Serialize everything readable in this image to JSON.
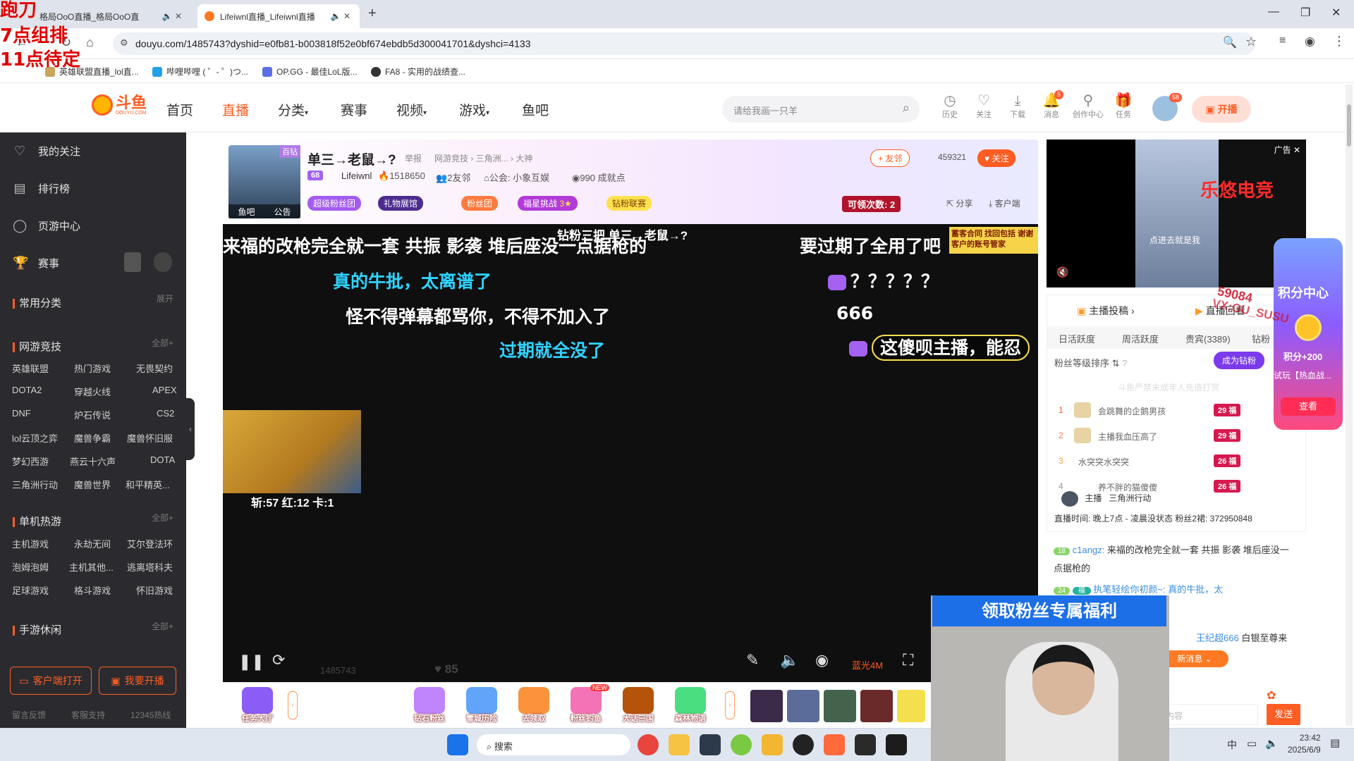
{
  "browser": {
    "tabs": [
      {
        "title": "格局OoO直播_格局OoO直",
        "active": false
      },
      {
        "title": "Lifeiwnl直播_Lifeiwnl直播",
        "active": true
      }
    ],
    "url": "douyu.com/1485743?dyshid=e0fb81-b003818f52e0bf674ebdb5d300041701&dyshci=4133",
    "bookmarks": [
      {
        "label": "英雄联盟直播_lol直..."
      },
      {
        "label": "哔哩哔哩 ( ゜- ゜)つ..."
      },
      {
        "label": "OP.GG - 最佳LoL版..."
      },
      {
        "label": "FA8 - 实用的战绩查..."
      }
    ]
  },
  "overlay_note": [
    "跑刀",
    "7点组排",
    "11点待定"
  ],
  "site": {
    "logo_text": "斗鱼",
    "logo_sub": "DOUYU.COM",
    "nav": [
      "首页",
      "直播",
      "分类",
      "赛事",
      "视频",
      "游戏",
      "鱼吧"
    ],
    "search_placeholder": "请给我画一只羊",
    "header_icons": [
      {
        "label": "历史",
        "icon": "clock-icon"
      },
      {
        "label": "关注",
        "icon": "heart-icon"
      },
      {
        "label": "下载",
        "icon": "download-icon"
      },
      {
        "label": "消息",
        "icon": "bell-icon",
        "badge": "5"
      },
      {
        "label": "创作中心",
        "icon": "bulb-icon"
      },
      {
        "label": "任务",
        "icon": "gift-icon"
      }
    ],
    "avatar_badge": "58",
    "start_live_label": "开播"
  },
  "sidebar": {
    "top_items": [
      {
        "label": "我的关注",
        "icon": "heart-icon"
      },
      {
        "label": "排行榜",
        "icon": "ranking-icon"
      },
      {
        "label": "页游中心",
        "icon": "gamepad-icon"
      },
      {
        "label": "赛事",
        "icon": "trophy-icon"
      }
    ],
    "common": {
      "title": "常用分类",
      "action": "展开"
    },
    "sections": [
      {
        "title": "网游竞技",
        "action": "全部",
        "games": [
          "英雄联盟",
          "热门游戏",
          "无畏契约",
          "DOTA2",
          "穿越火线",
          "APEX",
          "DNF",
          "炉石传说",
          "CS2",
          "lol云顶之弈",
          "魔兽争霸",
          "魔兽怀旧服",
          "梦幻西游",
          "燕云十六声",
          "DOTA",
          "三角洲行动",
          "魔兽世界",
          "和平精英..."
        ]
      },
      {
        "title": "单机热游",
        "action": "全部",
        "games": [
          "主机游戏",
          "永劫无间",
          "艾尔登法环",
          "泡姆泡姆",
          "主机其他...",
          "逃离塔科夫",
          "足球游戏",
          "格斗游戏",
          "怀旧游戏"
        ]
      },
      {
        "title": "手游休闲",
        "action": "全部",
        "games": []
      }
    ],
    "buttons": [
      "客户端打开",
      "我要开播"
    ],
    "footer": [
      "留言反馈",
      "客服支持",
      "12345热线"
    ]
  },
  "room": {
    "title": "单三→老鼠→?",
    "report": "举报",
    "category": "网游竞技 › 三角洲... › 大神",
    "badge_level": "68",
    "streamer": "Lifeiwnl",
    "hot": "1518650",
    "neighbors": "2友邻",
    "guild": "公会: 小象互娱",
    "achievements": "990 成就点",
    "thumb_tabs": [
      "鱼吧",
      "公告"
    ],
    "tags": [
      "超级粉丝团",
      "礼物展馆",
      "粉丝团",
      "福星挑战",
      "钻粉联赛"
    ],
    "challenge_stars": "3",
    "friend_label": "友邻",
    "follow_count": "459321",
    "follow_label": "关注",
    "claim_label": "可领次数: 2",
    "share_label": "分享",
    "client_label": "客户端",
    "diamond_label": "百钻"
  },
  "video": {
    "top_title": "钻粉三把 单三→老鼠→?",
    "danmaku": [
      {
        "text": "来福的改枪完全就一套 共振 影袭 堆后座没一点据枪的",
        "color": "#ffffff"
      },
      {
        "text": "要过期了全用了吧",
        "color": "#ffffff"
      },
      {
        "text": "真的牛批，太离谱了",
        "color": "#2fd3ff"
      },
      {
        "text": "？？？？？",
        "color": "#ffffff"
      },
      {
        "text": "怪不得弹幕都骂你，不得不加入了",
        "color": "#ffffff"
      },
      {
        "text": "666",
        "color": "#ffffff"
      },
      {
        "text": "过期就全没了",
        "color": "#2fd3ff"
      },
      {
        "text": "这傻呗主播，能忍",
        "color": "#ffffff"
      }
    ],
    "stats": "斩:57 红:12 卡:1",
    "quality": "蓝光4M",
    "room_id": "1485743",
    "hot_bottom": "85",
    "top_banner": "蓄客合同 找回包括 谢谢客户的账号管家"
  },
  "giftbar": {
    "task_label": "任务大厅",
    "gifts": [
      "钻石粉丝",
      "雪城历险",
      "去领取",
      "粉丝钓鱼",
      "大话三国",
      "森林物语"
    ],
    "new_tag": "NEW"
  },
  "ad": {
    "label": "广告",
    "brand": "乐悠电竞",
    "caption": "点进去就是我"
  },
  "rank": {
    "submit_label": "主播投稿",
    "review_label": "直播回看",
    "tabs": [
      "日活跃度",
      "周活跃度",
      "贵宾(3389)",
      "钻粉"
    ],
    "sort_label": "粉丝等级排序",
    "become_label": "成为钻粉",
    "notice": "斗鱼严禁未成年人充值打赏",
    "users": [
      {
        "rank": "1",
        "name": "会跳舞的企鹅男孩",
        "level": "29"
      },
      {
        "rank": "2",
        "name": "主播我血压高了",
        "level": "29"
      },
      {
        "rank": "3",
        "name": "水突突水突突",
        "level": "26"
      },
      {
        "rank": "4",
        "name": "养不胖的猫傻傻",
        "level": "26"
      }
    ],
    "fan_tag": "福"
  },
  "chat": {
    "host_tags": [
      "主播",
      "三角洲行动"
    ],
    "live_info": "直播时间: 晚上7点 - 凌晨没状态 粉丝2裙: 372950848",
    "messages": [
      {
        "level": "18",
        "user": "c1angz:",
        "text": "来福的改枪完全就一套 共振 影袭 堆后座没一点据枪的"
      },
      {
        "level": "24",
        "user": "执笔轻绘你初颜~:",
        "text": "真的牛批，太"
      }
    ],
    "system_user": "王纪超666",
    "system_text": "白银至尊来",
    "new_msg": "新消息",
    "send_label": "发送",
    "input_placeholder": "内容"
  },
  "points": {
    "title": "积分中心",
    "reward": "积分+200",
    "desc": "试玩【热血战...",
    "button": "查看"
  },
  "watermark": [
    "59084",
    "VX:GU_SUSU"
  ],
  "cam": {
    "banner": "领取粉丝专属福利"
  },
  "taskbar": {
    "search": "搜索",
    "ime": "中",
    "time": "23:42",
    "date": "2025/6/9"
  }
}
